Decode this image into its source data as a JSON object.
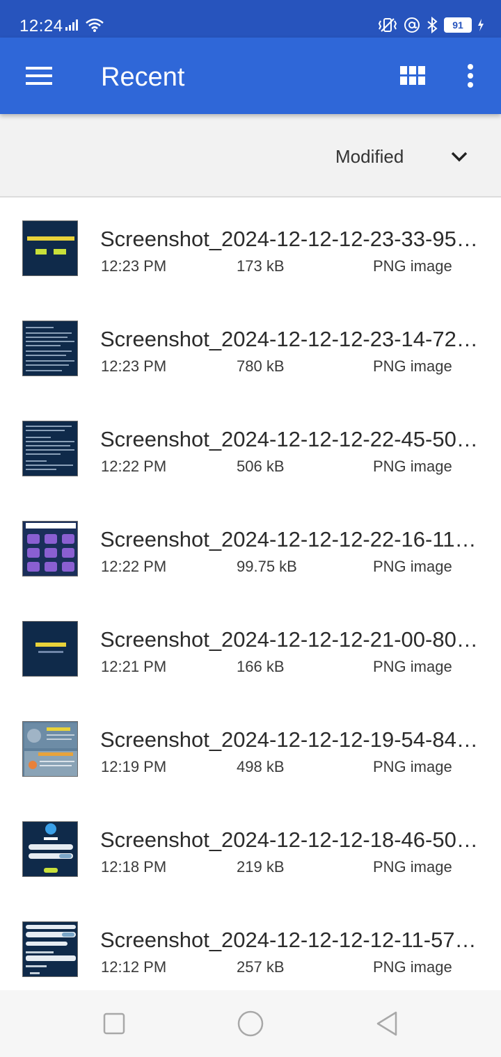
{
  "status_bar": {
    "time": "12:24",
    "battery": "91"
  },
  "app_bar": {
    "title": "Recent"
  },
  "sort": {
    "label": "Modified"
  },
  "files": [
    {
      "name": "Screenshot_2024-12-12-12-23-33-95…",
      "time": "12:23 PM",
      "size": "173 kB",
      "type": "PNG image"
    },
    {
      "name": "Screenshot_2024-12-12-12-23-14-72…",
      "time": "12:23 PM",
      "size": "780 kB",
      "type": "PNG image"
    },
    {
      "name": "Screenshot_2024-12-12-12-22-45-50…",
      "time": "12:22 PM",
      "size": "506 kB",
      "type": "PNG image"
    },
    {
      "name": "Screenshot_2024-12-12-12-22-16-11…",
      "time": "12:22 PM",
      "size": "99.75 kB",
      "type": "PNG image"
    },
    {
      "name": "Screenshot_2024-12-12-12-21-00-80…",
      "time": "12:21 PM",
      "size": "166 kB",
      "type": "PNG image"
    },
    {
      "name": "Screenshot_2024-12-12-12-19-54-84…",
      "time": "12:19 PM",
      "size": "498 kB",
      "type": "PNG image"
    },
    {
      "name": "Screenshot_2024-12-12-12-18-46-50…",
      "time": "12:18 PM",
      "size": "219 kB",
      "type": "PNG image"
    },
    {
      "name": "Screenshot_2024-12-12-12-12-11-57…",
      "time": "12:12 PM",
      "size": "257 kB",
      "type": "PNG image"
    }
  ],
  "icons": {
    "menu": "hamburger-menu-icon",
    "grid": "grid-view-icon",
    "more": "more-vertical-icon",
    "sort": "chevron-down-icon",
    "nav_recents": "square-icon",
    "nav_home": "circle-icon",
    "nav_back": "back-triangle-icon"
  },
  "colors": {
    "status_bar": "#2754bd",
    "app_bar": "#2f67d8",
    "sort_bar": "#f2f2f2"
  }
}
